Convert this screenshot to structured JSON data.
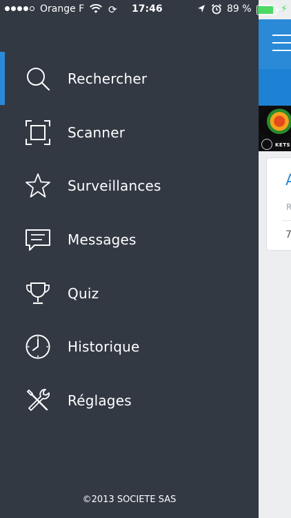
{
  "status_bar": {
    "carrier": "Orange F",
    "time": "17:46",
    "battery": "89 %",
    "battery_level": 0.89
  },
  "menu": {
    "items": [
      {
        "label": "Rechercher",
        "icon": "search-icon",
        "active": true
      },
      {
        "label": "Scanner",
        "icon": "scan-frame-icon"
      },
      {
        "label": "Surveillances",
        "icon": "star-icon"
      },
      {
        "label": "Messages",
        "icon": "speech-bubble-icon"
      },
      {
        "label": "Quiz",
        "icon": "trophy-icon"
      },
      {
        "label": "Historique",
        "icon": "clock-icon"
      },
      {
        "label": "Réglages",
        "icon": "tools-icon"
      }
    ]
  },
  "footer": {
    "text": "©2013 SOCIETE SAS"
  },
  "background_app": {
    "banner_text": "KETS",
    "card_title": "A",
    "card_sub": "R",
    "card_value": "7"
  },
  "colors": {
    "drawer": "#333943",
    "accent": "#2a8ad8",
    "battery": "#4cd964"
  }
}
